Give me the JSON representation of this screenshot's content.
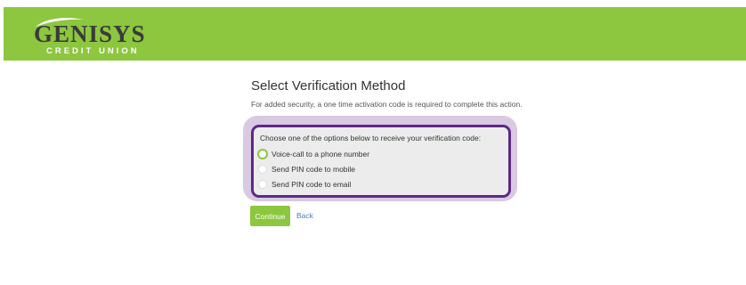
{
  "brand": {
    "name": "GENISYS",
    "subtitle": "CREDIT UNION",
    "header_color": "#8dc63f",
    "accent_purple": "#5c2a83"
  },
  "page": {
    "title": "Select Verification Method",
    "description": "For added security, a one time activation code is required to complete this action."
  },
  "verification": {
    "prompt": "Choose one of the options below to receive your verification code:",
    "options": [
      {
        "label": "Voice-call to a phone number",
        "selected": true
      },
      {
        "label": "Send PIN code to mobile",
        "selected": false
      },
      {
        "label": "Send PIN code to email",
        "selected": false
      }
    ]
  },
  "actions": {
    "continue_label": "Continue",
    "back_label": "Back"
  }
}
